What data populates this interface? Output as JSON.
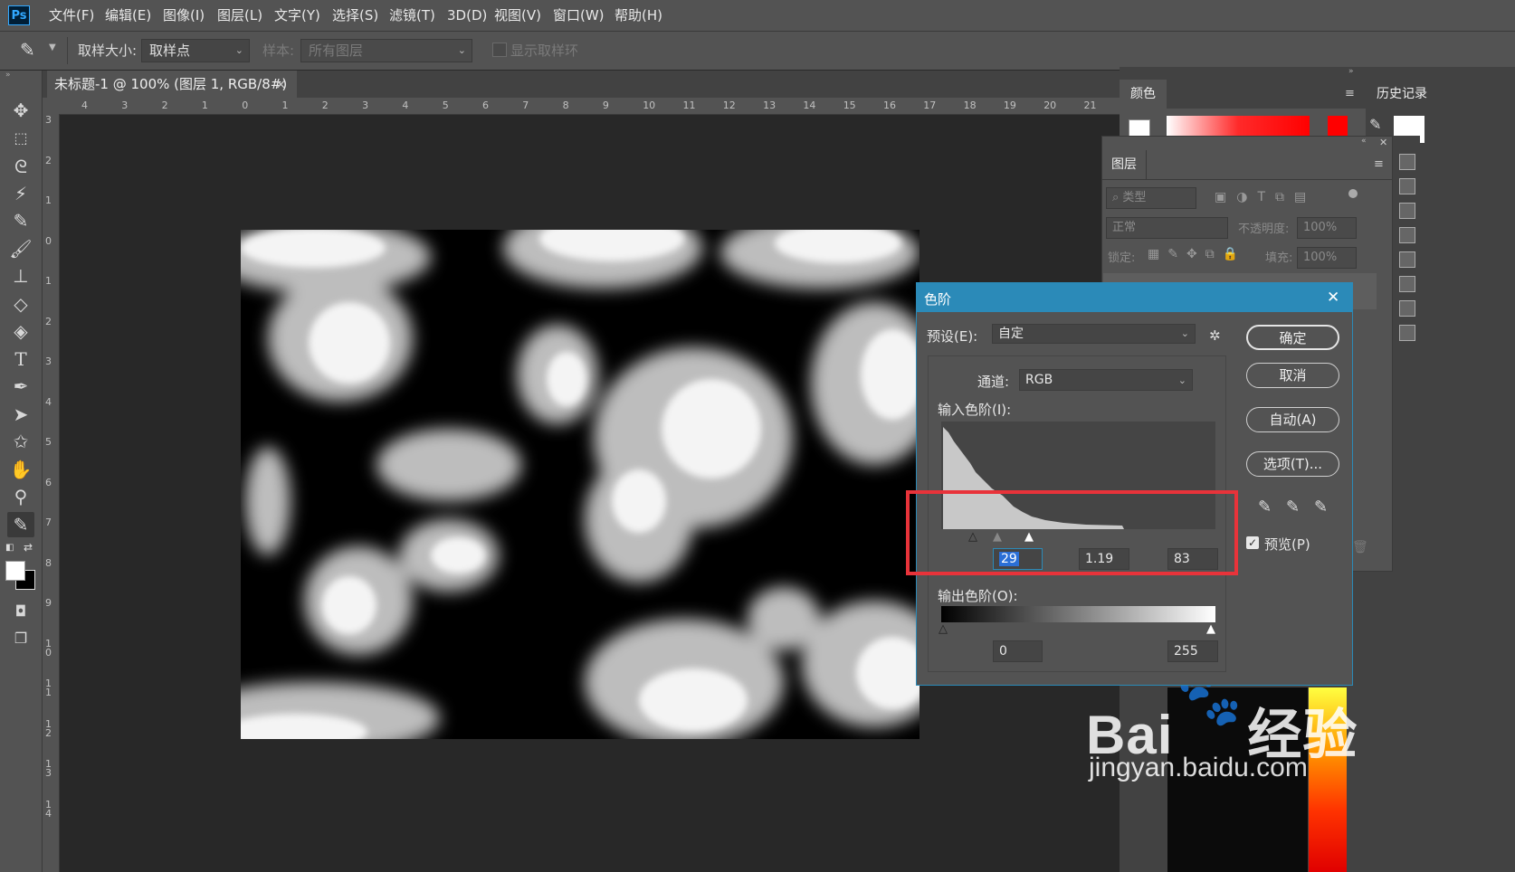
{
  "app": {
    "logo": "Ps"
  },
  "menu": [
    "文件(F)",
    "编辑(E)",
    "图像(I)",
    "图层(L)",
    "文字(Y)",
    "选择(S)",
    "滤镜(T)",
    "3D(D)",
    "视图(V)",
    "窗口(W)",
    "帮助(H)"
  ],
  "options": {
    "sample_size_label": "取样大小:",
    "sample_size_value": "取样点",
    "sample_label": "样本:",
    "sample_value": "所有图层",
    "show_ring_label": "显示取样环"
  },
  "tools": [
    "move-tool",
    "marquee-tool",
    "lasso-tool",
    "magic-wand-tool",
    "eyedropper-tool",
    "brush-tool",
    "stamp-tool",
    "eraser-tool",
    "fill-tool",
    "text-tool",
    "pen-tool",
    "path-select-tool",
    "shape-tool",
    "hand-tool",
    "zoom-tool",
    "eyedropper-tool-active"
  ],
  "document": {
    "tab_title": "未标题-1 @ 100% (图层 1, RGB/8#) *",
    "close": "×",
    "ruler_h": [
      "4",
      "3",
      "2",
      "1",
      "0",
      "1",
      "2",
      "3",
      "4",
      "5",
      "6",
      "7",
      "8",
      "9",
      "10",
      "11",
      "12",
      "13",
      "14",
      "15",
      "16",
      "17",
      "18",
      "19",
      "20",
      "21"
    ],
    "ruler_v": [
      "3",
      "2",
      "1",
      "0",
      "1",
      "2",
      "3",
      "4",
      "5",
      "6",
      "7",
      "8",
      "9",
      "1 0",
      "1 1",
      "1 2",
      "1 3",
      "1 4"
    ]
  },
  "panels": {
    "color_tab": "颜色",
    "history_tab": "历史记录",
    "layers_tab": "图层",
    "filter_type": "类型",
    "blend_mode": "正常",
    "opacity_label": "不透明度:",
    "opacity_value": "100%",
    "lock_label": "锁定:",
    "fill_label": "填充:",
    "fill_value": "100%"
  },
  "dialog": {
    "title": "色阶",
    "close": "✕",
    "preset_label": "预设(E):",
    "preset_value": "自定",
    "channel_label": "通道:",
    "channel_value": "RGB",
    "input_label": "输入色阶(I):",
    "input_black": "29",
    "input_gamma": "1.19",
    "input_white": "83",
    "output_label": "输出色阶(O):",
    "output_black": "0",
    "output_white": "255",
    "btn_ok": "确定",
    "btn_cancel": "取消",
    "btn_auto": "自动(A)",
    "btn_options": "选项(T)...",
    "preview_label": "预览(P)",
    "preview_checked": true
  },
  "watermark": {
    "brand": "Bai",
    "brand2": "经验",
    "url": "jingyan.baidu.com"
  },
  "colors": {
    "dialog_title_bar": "#2b8ab8",
    "highlight_box": "#e8333a",
    "accent": "#31a8ff"
  }
}
